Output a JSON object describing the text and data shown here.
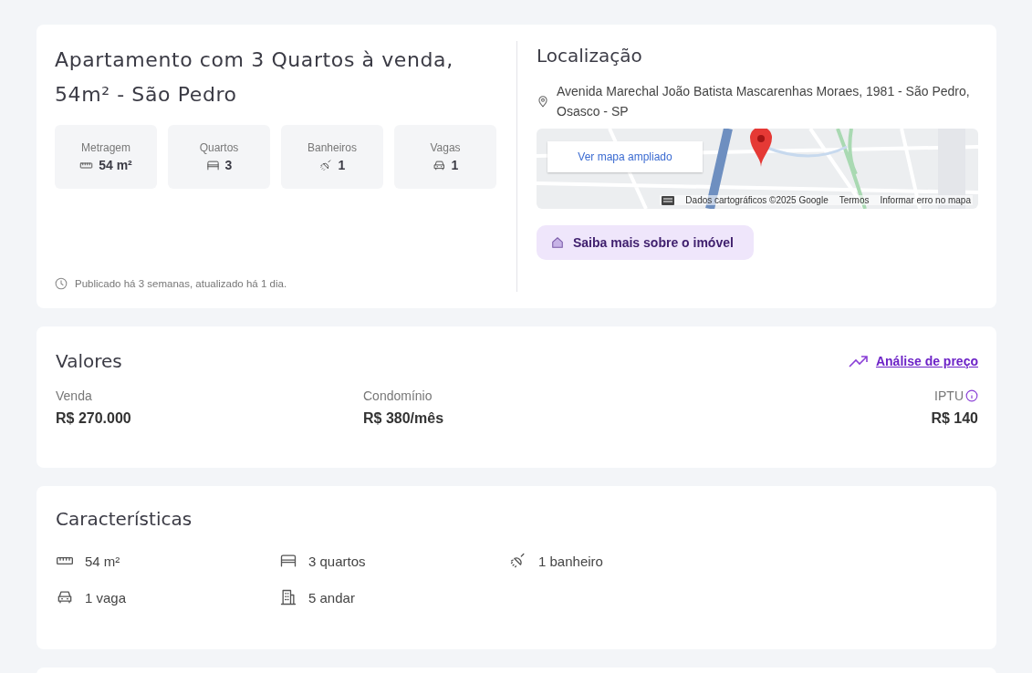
{
  "summary": {
    "title": "Apartamento com 3 Quartos à venda, 54m² - São Pedro",
    "stats": [
      {
        "kind": "area",
        "label": "Metragem",
        "value": "54 m²"
      },
      {
        "kind": "bedroom",
        "label": "Quartos",
        "value": "3"
      },
      {
        "kind": "bathroom",
        "label": "Banheiros",
        "value": "1"
      },
      {
        "kind": "parking",
        "label": "Vagas",
        "value": "1"
      }
    ],
    "published": "Publicado há 3 semanas, atualizado há 1 dia."
  },
  "location": {
    "title": "Localização",
    "address": "Avenida Marechal João Batista Mascarenhas Moraes, 1981 - São Pedro, Osasco - SP",
    "map": {
      "kind": "picture",
      "enlarge_button": "Ver mapa ampliado",
      "attribution": "Dados cartográficos ©2025 Google",
      "terms_link": "Termos",
      "report_link": "Informar erro no mapa"
    },
    "more_button": "Saiba mais sobre o imóvel"
  },
  "values": {
    "title": "Valores",
    "price_analysis_link": "Análise de preço",
    "items": [
      {
        "label": "Venda",
        "value": "R$ 270.000",
        "info": false
      },
      {
        "label": "Condomínio",
        "value": "R$ 380/mês",
        "info": false
      },
      {
        "label": "IPTU",
        "value": "R$ 140",
        "info": true
      }
    ]
  },
  "features": {
    "title": "Características",
    "items": [
      {
        "kind": "area",
        "label": "54 m²"
      },
      {
        "kind": "bedroom",
        "label": "3 quartos"
      },
      {
        "kind": "bathroom",
        "label": "1 banheiro"
      },
      {
        "kind": "parking",
        "label": "1 vaga"
      },
      {
        "kind": "floor",
        "label": "5 andar"
      }
    ]
  }
}
